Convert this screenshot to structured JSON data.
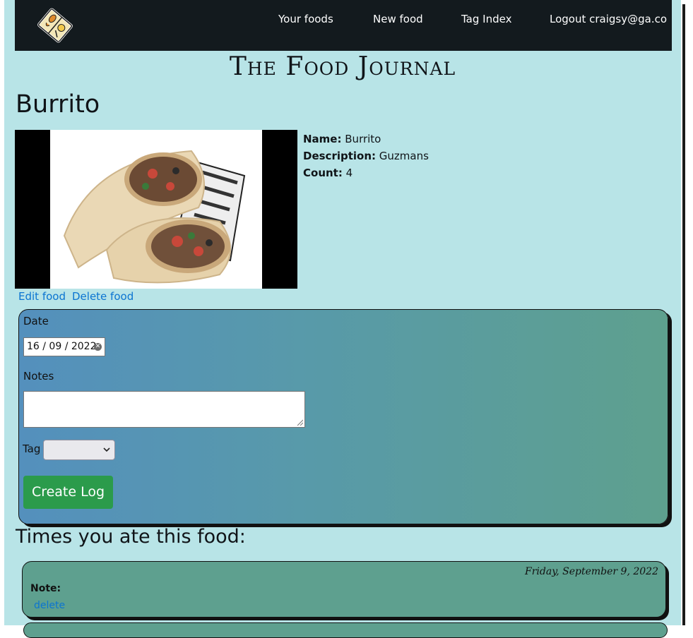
{
  "nav": {
    "links": [
      "Your foods",
      "New food",
      "Tag Index",
      "Logout craigsy@ga.co"
    ]
  },
  "site_title": "The Food Journal",
  "food": {
    "title": "Burrito",
    "name_label": "Name:",
    "name": "Burrito",
    "description_label": "Description:",
    "description": "Guzmans",
    "count_label": "Count:",
    "count": "4"
  },
  "actions": {
    "edit": "Edit food",
    "delete": "Delete food"
  },
  "form": {
    "date_label": "Date",
    "date_value": "16 / 09 / 2022",
    "notes_label": "Notes",
    "notes_value": "",
    "tag_label": "Tag",
    "tag_value": "",
    "submit": "Create Log"
  },
  "times_heading": "Times you ate this food:",
  "logs": [
    {
      "date": "Friday, September 9, 2022",
      "note_label": "Note:",
      "delete": "delete"
    }
  ],
  "colors": {
    "navbar": "#131a1e",
    "page_bg": "#b8e4e7",
    "link": "#0b74d1",
    "create_button": "#2b9b4b",
    "log_card": "#5ea08f"
  }
}
